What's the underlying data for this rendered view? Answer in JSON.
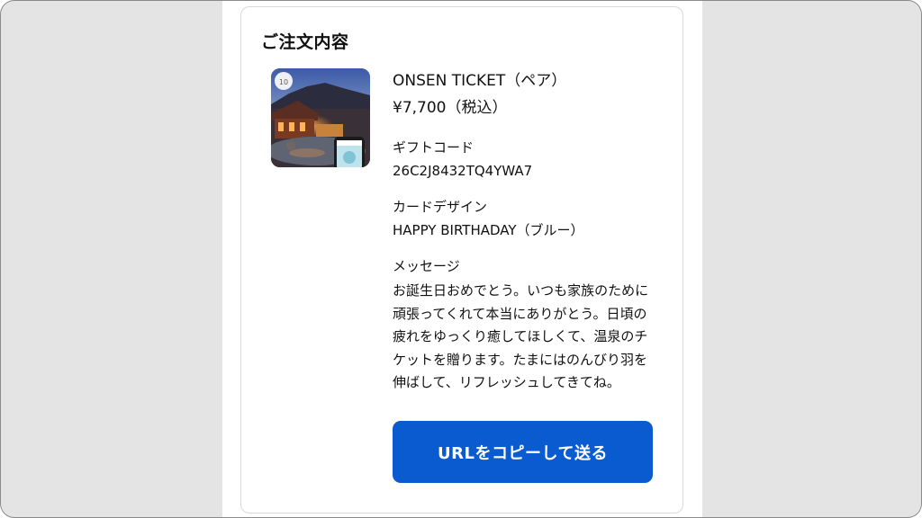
{
  "order": {
    "title": "ご注文内容",
    "product": {
      "name": "ONSEN TICKET（ペア）",
      "price": "¥7,700（税込）",
      "image_badge": "10"
    },
    "gift_code": {
      "label": "ギフトコード",
      "value": "26C2J8432TQ4YWA7"
    },
    "card_design": {
      "label": "カードデザイン",
      "value": "HAPPY BIRTHADAY（ブルー）"
    },
    "message": {
      "label": "メッセージ",
      "text": "お誕生日おめでとう。いつも家族のために頑張ってくれて本当にありがとう。日頃の疲れをゆっくり癒してほしくて、温泉のチケットを贈ります。たまにはのんびり羽を伸ばして、リフレッシュしてきてね。"
    },
    "copy_button_label": "URLをコピーして送る"
  },
  "colors": {
    "button": "#0a5bd0",
    "button_text": "#ffffff",
    "outer_background": "#e4e4e4",
    "card_border": "#d9d9d9"
  }
}
